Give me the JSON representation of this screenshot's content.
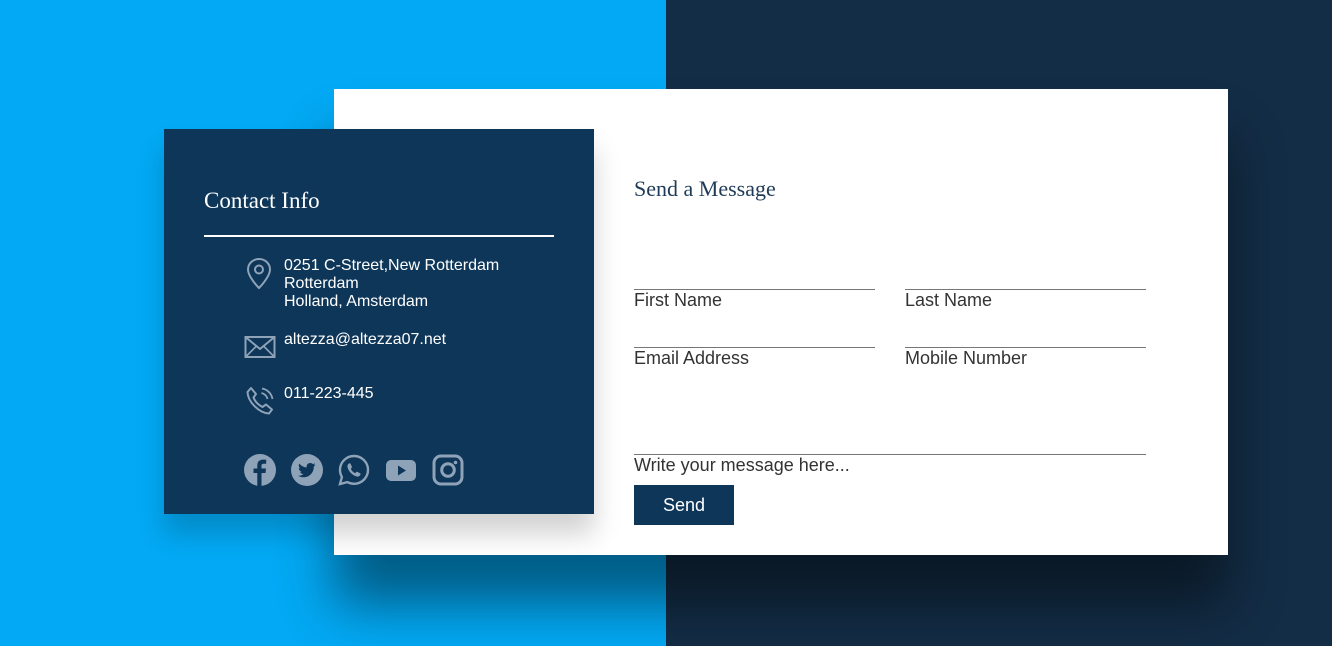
{
  "contact_info": {
    "title": "Contact Info",
    "address": {
      "icon": "location-pin-icon",
      "lines": [
        "0251 C-Street,New Rotterdam",
        "Rotterdam",
        "Holland, Amsterdam"
      ]
    },
    "email": {
      "icon": "envelope-icon",
      "value": "altezza@altezza07.net"
    },
    "phone": {
      "icon": "phone-icon",
      "value": "011-223-445"
    },
    "social": [
      "facebook-icon",
      "twitter-icon",
      "whatsapp-icon",
      "youtube-icon",
      "instagram-icon"
    ]
  },
  "form": {
    "title": "Send a Message",
    "fields": {
      "first_name": "First Name",
      "last_name": "Last Name",
      "email": "Email Address",
      "mobile": "Mobile Number",
      "message": "Write your message here..."
    },
    "send_label": "Send"
  },
  "colors": {
    "bg_left": "#03a9f4",
    "bg_right": "#132d46",
    "card_dark": "#0e3659",
    "icon_muted": "#8fa3b8"
  }
}
